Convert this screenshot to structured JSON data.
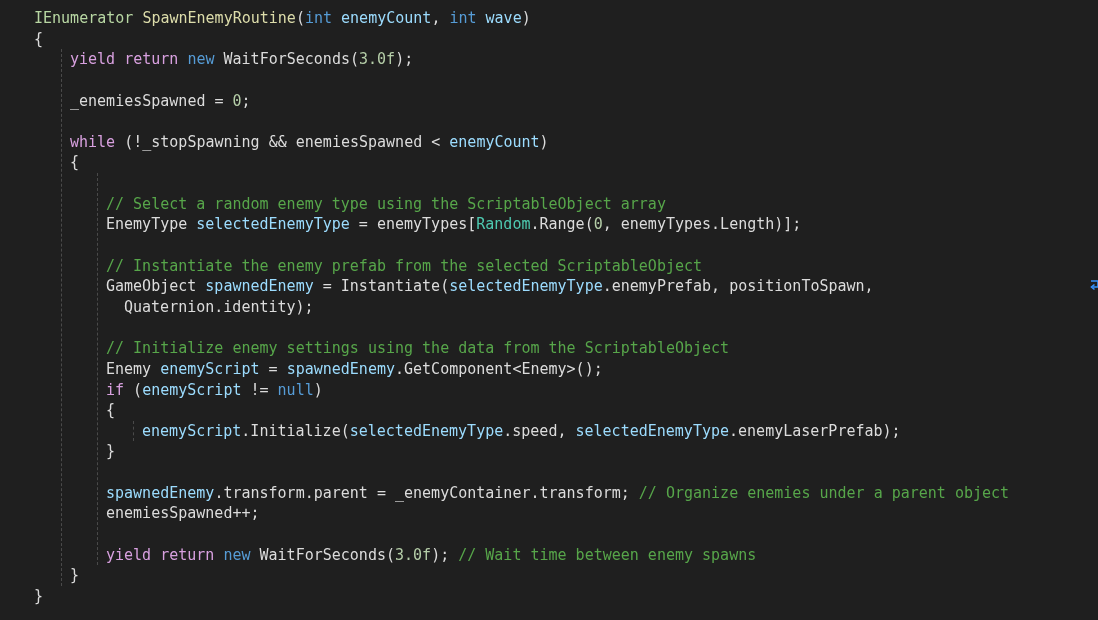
{
  "code": {
    "lines": [
      {
        "kind": "code",
        "tokens": [
          {
            "kind": "interface",
            "text": "IEnumerator "
          },
          {
            "kind": "method",
            "text": "SpawnEnemyRoutine"
          },
          {
            "kind": "plain",
            "text": "("
          },
          {
            "kind": "keyword",
            "text": "int "
          },
          {
            "kind": "local",
            "text": "enemyCount"
          },
          {
            "kind": "plain",
            "text": ", "
          },
          {
            "kind": "keyword",
            "text": "int "
          },
          {
            "kind": "local",
            "text": "wave"
          },
          {
            "kind": "plain",
            "text": ")"
          }
        ]
      },
      {
        "kind": "code",
        "tokens": [
          {
            "kind": "plain",
            "text": "{"
          }
        ]
      },
      {
        "kind": "block",
        "children": [
          {
            "kind": "code",
            "tokens": [
              {
                "kind": "control",
                "text": "yield return "
              },
              {
                "kind": "keyword",
                "text": "new"
              },
              {
                "kind": "plain",
                "text": " WaitForSeconds("
              },
              {
                "kind": "number",
                "text": "3.0f"
              },
              {
                "kind": "plain",
                "text": ");"
              }
            ]
          },
          {
            "kind": "blank"
          },
          {
            "kind": "code",
            "tokens": [
              {
                "kind": "plain",
                "text": "_enemiesSpawned = "
              },
              {
                "kind": "number",
                "text": "0"
              },
              {
                "kind": "plain",
                "text": ";"
              }
            ]
          },
          {
            "kind": "blank"
          },
          {
            "kind": "code",
            "tokens": [
              {
                "kind": "control",
                "text": "while"
              },
              {
                "kind": "plain",
                "text": " (!_stopSpawning && enemiesSpawned < "
              },
              {
                "kind": "local",
                "text": "enemyCount"
              },
              {
                "kind": "plain",
                "text": ")"
              }
            ]
          },
          {
            "kind": "code",
            "tokens": [
              {
                "kind": "plain",
                "text": "{"
              }
            ]
          },
          {
            "kind": "block",
            "children": [
              {
                "kind": "blank"
              },
              {
                "kind": "code",
                "tokens": [
                  {
                    "kind": "comment",
                    "text": "// Select a random enemy type using the ScriptableObject array"
                  }
                ]
              },
              {
                "kind": "code",
                "tokens": [
                  {
                    "kind": "plain",
                    "text": "EnemyType "
                  },
                  {
                    "kind": "local",
                    "text": "selectedEnemyType"
                  },
                  {
                    "kind": "plain",
                    "text": " = enemyTypes["
                  },
                  {
                    "kind": "class",
                    "text": "Random"
                  },
                  {
                    "kind": "plain",
                    "text": ".Range("
                  },
                  {
                    "kind": "number",
                    "text": "0"
                  },
                  {
                    "kind": "plain",
                    "text": ", enemyTypes.Length)];"
                  }
                ]
              },
              {
                "kind": "blank"
              },
              {
                "kind": "code",
                "tokens": [
                  {
                    "kind": "comment",
                    "text": "// Instantiate the enemy prefab from the selected ScriptableObject"
                  }
                ]
              },
              {
                "kind": "code",
                "wrap_mark": true,
                "tokens": [
                  {
                    "kind": "plain",
                    "text": "GameObject "
                  },
                  {
                    "kind": "local",
                    "text": "spawnedEnemy"
                  },
                  {
                    "kind": "plain",
                    "text": " = Instantiate("
                  },
                  {
                    "kind": "local",
                    "text": "selectedEnemyType"
                  },
                  {
                    "kind": "plain",
                    "text": ".enemyPrefab, positionToSpawn,"
                  }
                ]
              },
              {
                "kind": "wrap",
                "tokens": [
                  {
                    "kind": "plain",
                    "text": "Quaternion.identity);"
                  }
                ]
              },
              {
                "kind": "blank"
              },
              {
                "kind": "code",
                "tokens": [
                  {
                    "kind": "comment",
                    "text": "// Initialize enemy settings using the data from the ScriptableObject"
                  }
                ]
              },
              {
                "kind": "code",
                "tokens": [
                  {
                    "kind": "plain",
                    "text": "Enemy "
                  },
                  {
                    "kind": "local",
                    "text": "enemyScript"
                  },
                  {
                    "kind": "plain",
                    "text": " = "
                  },
                  {
                    "kind": "local",
                    "text": "spawnedEnemy"
                  },
                  {
                    "kind": "plain",
                    "text": ".GetComponent<Enemy>();"
                  }
                ]
              },
              {
                "kind": "code",
                "tokens": [
                  {
                    "kind": "control",
                    "text": "if"
                  },
                  {
                    "kind": "plain",
                    "text": " ("
                  },
                  {
                    "kind": "local",
                    "text": "enemyScript"
                  },
                  {
                    "kind": "plain",
                    "text": " != "
                  },
                  {
                    "kind": "keyword",
                    "text": "null"
                  },
                  {
                    "kind": "plain",
                    "text": ")"
                  }
                ]
              },
              {
                "kind": "code",
                "tokens": [
                  {
                    "kind": "plain",
                    "text": "{"
                  }
                ]
              },
              {
                "kind": "block",
                "children": [
                  {
                    "kind": "code",
                    "tokens": [
                      {
                        "kind": "local",
                        "text": "enemyScript"
                      },
                      {
                        "kind": "plain",
                        "text": ".Initialize("
                      },
                      {
                        "kind": "local",
                        "text": "selectedEnemyType"
                      },
                      {
                        "kind": "plain",
                        "text": ".speed, "
                      },
                      {
                        "kind": "local",
                        "text": "selectedEnemyType"
                      },
                      {
                        "kind": "plain",
                        "text": ".enemyLaserPrefab);"
                      }
                    ]
                  }
                ]
              },
              {
                "kind": "code",
                "tokens": [
                  {
                    "kind": "plain",
                    "text": "}"
                  }
                ]
              },
              {
                "kind": "blank"
              },
              {
                "kind": "code",
                "tokens": [
                  {
                    "kind": "local",
                    "text": "spawnedEnemy"
                  },
                  {
                    "kind": "plain",
                    "text": ".transform.parent = _enemyContainer.transform; "
                  },
                  {
                    "kind": "comment",
                    "text": "// Organize enemies under a parent object"
                  }
                ]
              },
              {
                "kind": "code",
                "tokens": [
                  {
                    "kind": "plain",
                    "text": "enemiesSpawned++;"
                  }
                ]
              },
              {
                "kind": "blank"
              },
              {
                "kind": "code",
                "tokens": [
                  {
                    "kind": "control",
                    "text": "yield return "
                  },
                  {
                    "kind": "keyword",
                    "text": "new"
                  },
                  {
                    "kind": "plain",
                    "text": " WaitForSeconds("
                  },
                  {
                    "kind": "number",
                    "text": "3.0f"
                  },
                  {
                    "kind": "plain",
                    "text": "); "
                  },
                  {
                    "kind": "comment",
                    "text": "// Wait time between enemy spawns"
                  }
                ]
              }
            ]
          },
          {
            "kind": "code",
            "tokens": [
              {
                "kind": "plain",
                "text": "}"
              }
            ]
          }
        ]
      },
      {
        "kind": "code",
        "tokens": [
          {
            "kind": "plain",
            "text": "}"
          }
        ]
      }
    ]
  }
}
